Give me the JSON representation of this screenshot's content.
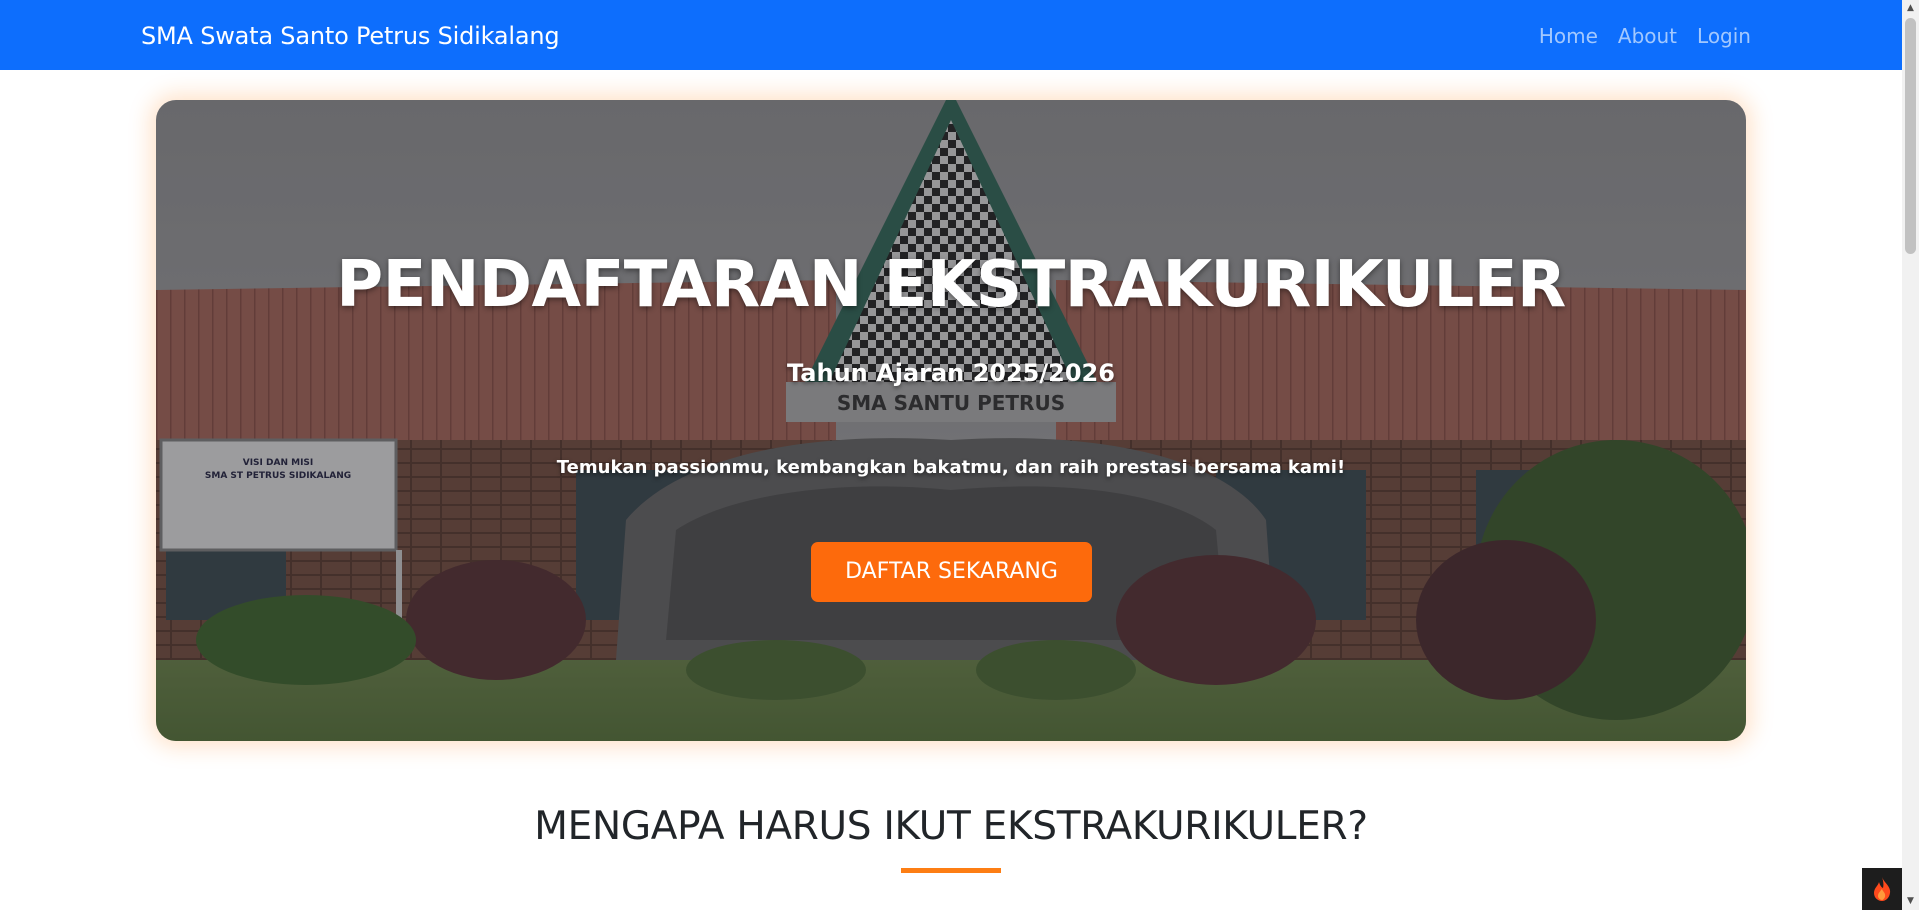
{
  "navbar": {
    "brand": "SMA Swata Santo Petrus Sidikalang",
    "links": [
      "Home",
      "About",
      "Login"
    ]
  },
  "hero": {
    "title": "PENDAFTARAN EKSTRAKURIKULER",
    "year": "Tahun Ajaran 2025/2026",
    "tagline": "Temukan passionmu, kembangkan bakatmu, dan raih prestasi bersama kami!",
    "cta_label": "DAFTAR SEKARANG",
    "sign_text": "SMA SANTU PETRUS",
    "board_line1": "VISI DAN MISI",
    "board_line2": "SMA ST PETRUS SIDIKALANG"
  },
  "section": {
    "title": "MENGAPA HARUS IKUT EKSTRAKURIKULER?"
  },
  "colors": {
    "navbar": "#0d6efd",
    "accent": "#fd7e14",
    "cta": "#fd6a0c"
  },
  "icons": {
    "dev_badge": "flame-icon",
    "scroll_up": "caret-up-icon",
    "scroll_down": "caret-down-icon"
  }
}
